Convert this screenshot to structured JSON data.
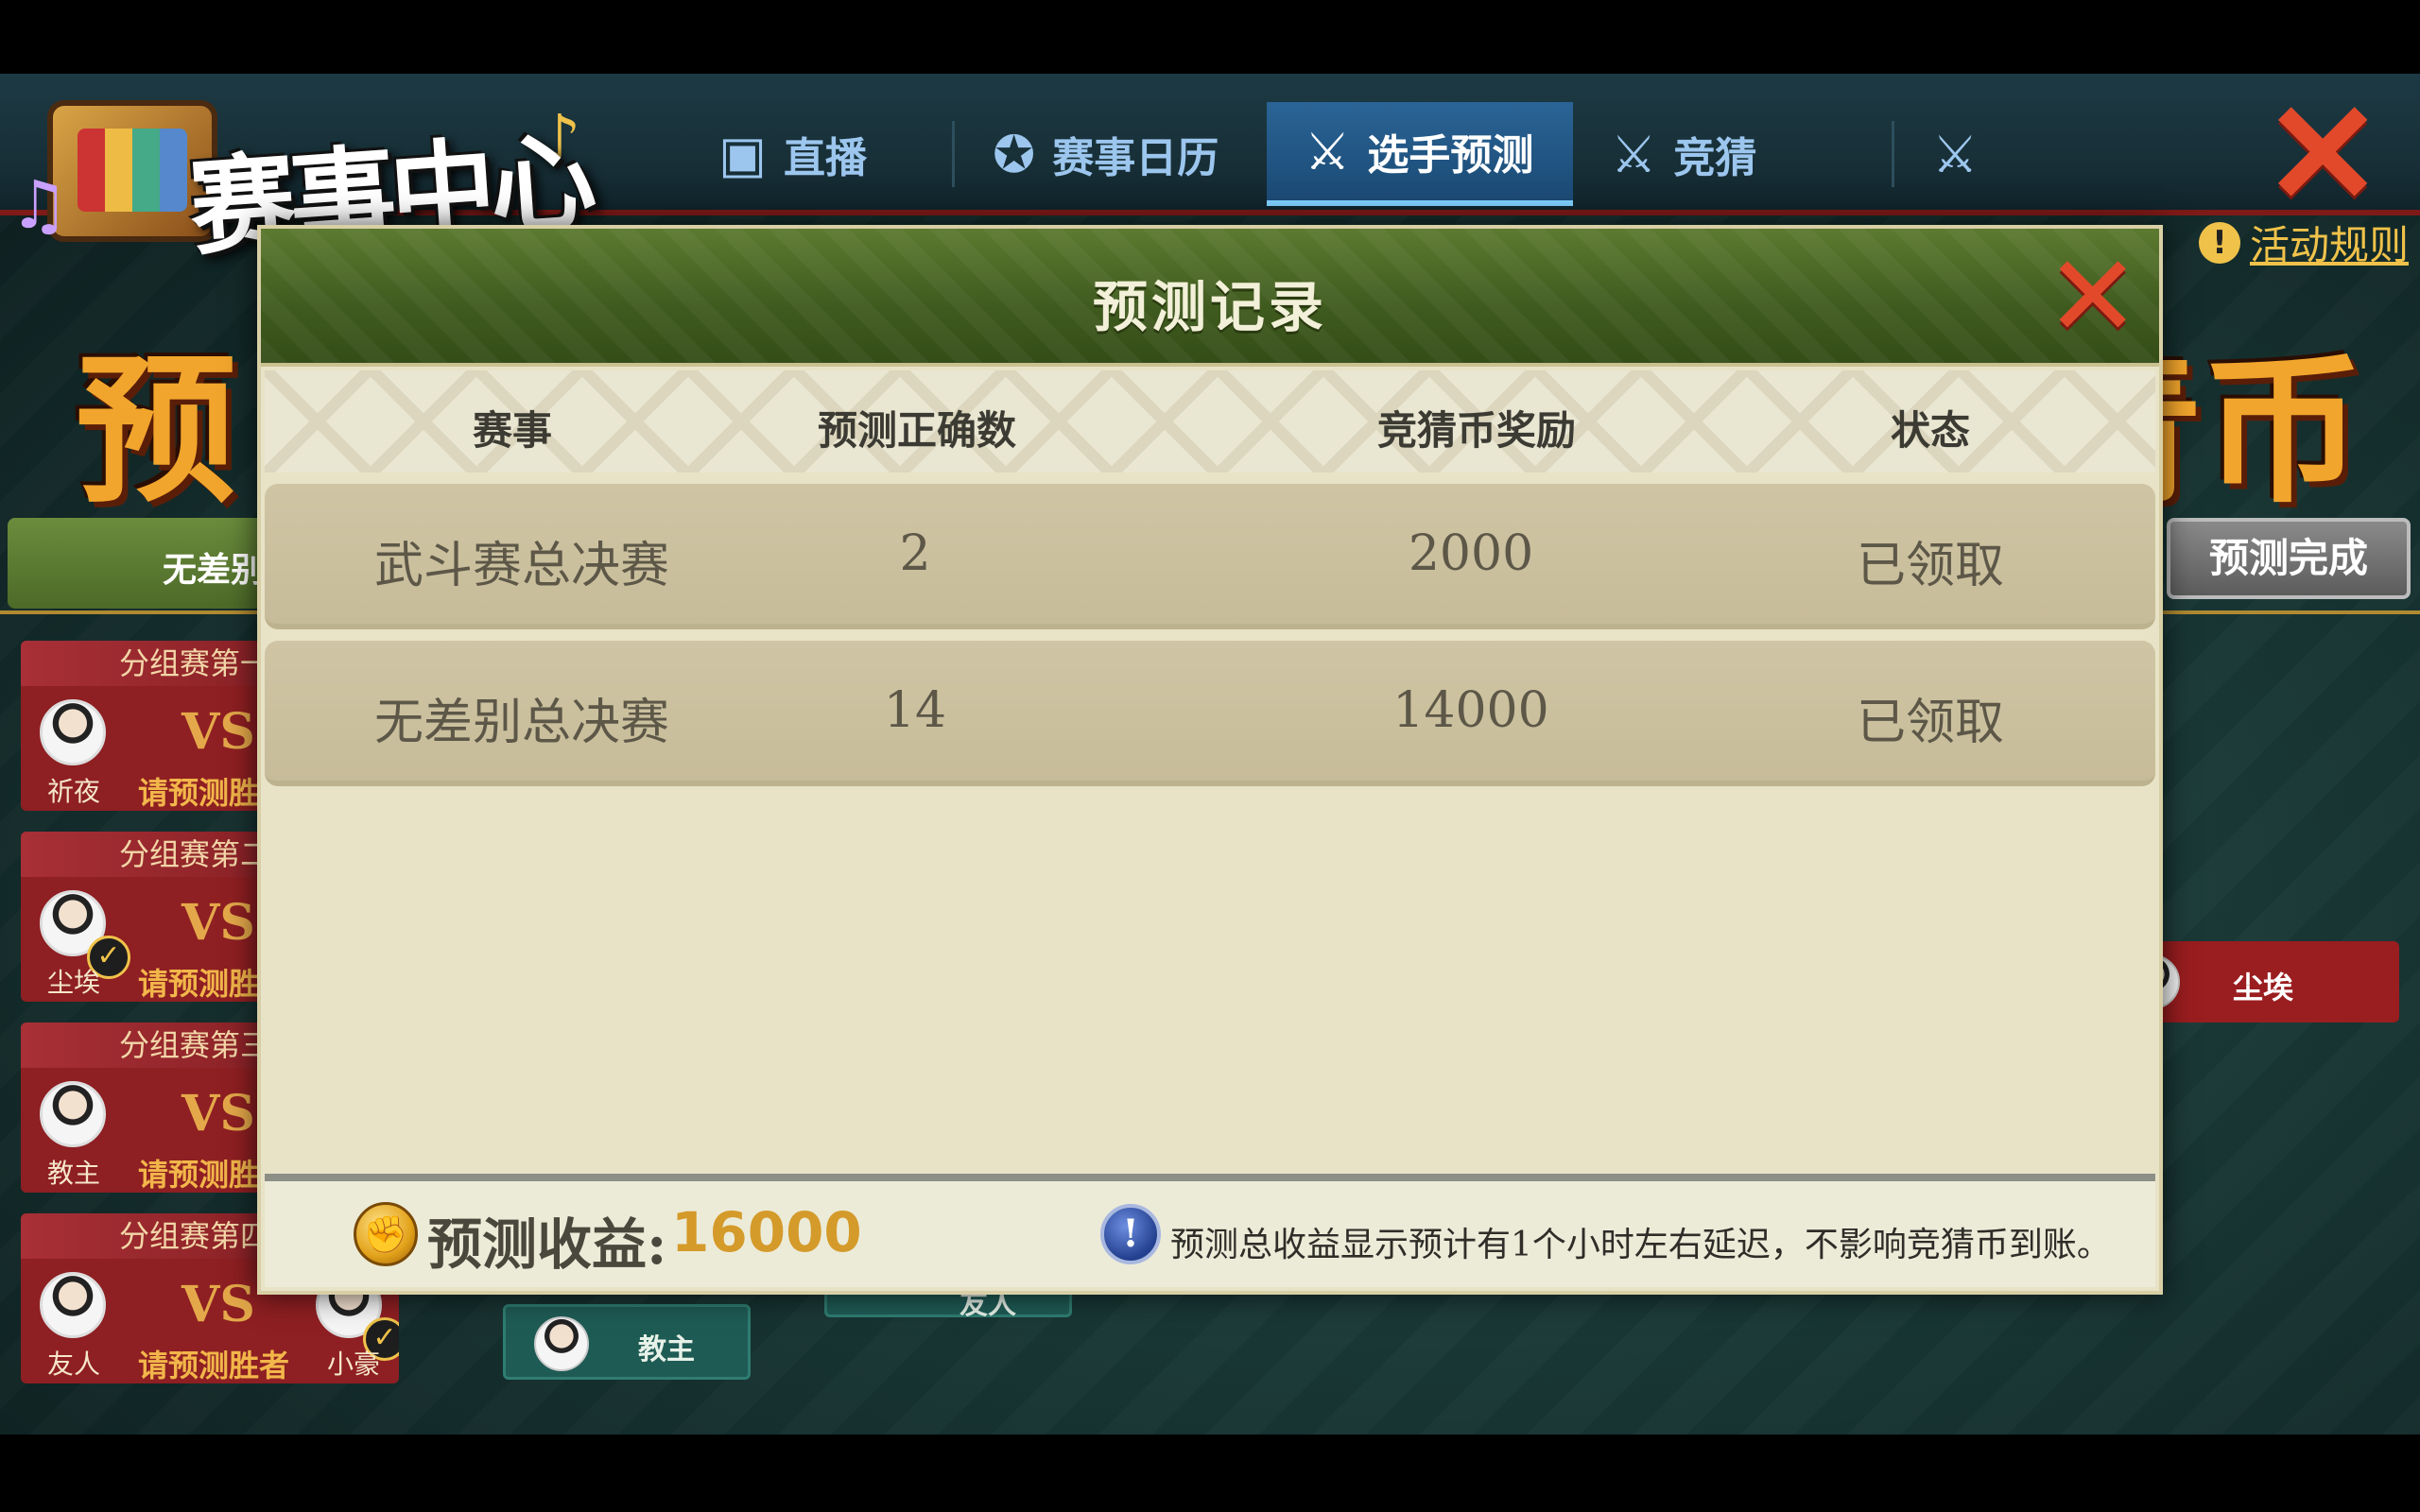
{
  "header": {
    "logo_title": "赛事中心",
    "tabs": [
      {
        "label": "直播",
        "icon": "tv-icon"
      },
      {
        "label": "赛事日历",
        "icon": "star-circle-icon"
      },
      {
        "label": "选手预测",
        "icon": "ninja-run-icon",
        "active": true
      },
      {
        "label": "竞猜",
        "icon": "ninja-run-icon"
      }
    ],
    "rules_label": "活动规则"
  },
  "background": {
    "big_title_left": "预",
    "big_title_right": "青币",
    "subtab_label": "无差别",
    "done_button": "预测完成",
    "match_cards": [
      {
        "head": "分组赛第一",
        "player": "祈夜",
        "vs": "VS",
        "pick": "请预测胜",
        "checked": false
      },
      {
        "head": "分组赛第二",
        "player": "尘埃",
        "vs": "VS",
        "pick": "请预测胜",
        "checked": true
      },
      {
        "head": "分组赛第三",
        "player": "教主",
        "vs": "VS",
        "pick": "请预测胜",
        "checked": false
      },
      {
        "head": "分组赛第四",
        "player": "友人",
        "vs": "VS",
        "pick": "请预测胜者",
        "player2": "小豪",
        "checked2": true
      }
    ],
    "bracket_slot": "教主",
    "bracket_slot_partial": "友人",
    "right_slot": "尘埃"
  },
  "modal": {
    "title": "预测记录",
    "columns": [
      "赛事",
      "预测正确数",
      "竞猜币奖励",
      "状态"
    ],
    "rows": [
      {
        "event": "武斗赛总决赛",
        "correct": "2",
        "reward": "2000",
        "status": "已领取"
      },
      {
        "event": "无差别总决赛",
        "correct": "14",
        "reward": "14000",
        "status": "已领取"
      }
    ],
    "footer": {
      "income_label": "预测收益:",
      "income_value": "16000",
      "note": "预测总收益显示预计有1个小时左右延迟，不影响竞猜币到账。"
    }
  },
  "colors": {
    "accent_red": "#e2492a",
    "gold": "#d49a2a",
    "modal_header_green": "#4a6a24",
    "row_beige": "#cfc5a4"
  }
}
